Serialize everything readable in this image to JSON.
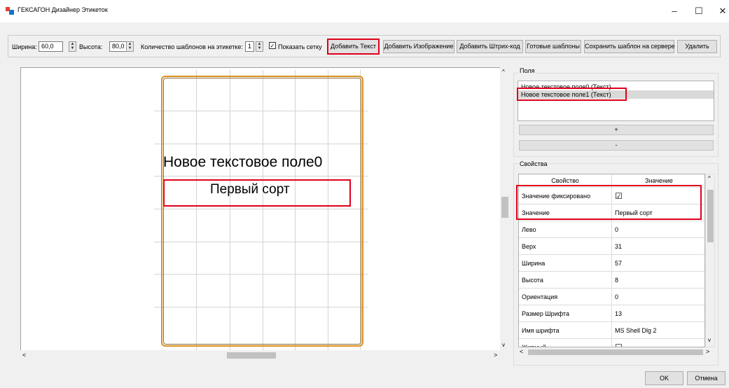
{
  "window": {
    "title": "ГЕКСАГОН Дизайнер Этикеток",
    "minimize": "–",
    "maximize": "☐",
    "close": "✕"
  },
  "toolbar": {
    "width_label": "Ширина:",
    "width_value": "60,0",
    "height_label": "Высота:",
    "height_value": "80,0",
    "count_label": "Количество шаблонов на этикетке:",
    "count_value": "1",
    "show_grid_label": "Показать сетку",
    "show_grid_checked": true,
    "add_text": "Добавить Текст",
    "add_image": "Добавить Изображение",
    "add_barcode": "Добавить Штрих-код",
    "ready_templates": "Готовые шаблоны",
    "save_template": "Сохранить шаблон на сервере",
    "delete": "Удалить"
  },
  "canvas": {
    "field0_text": "Новое текстовое поле0",
    "field1_text": "Первый сорт"
  },
  "fields_panel": {
    "title": "Поля",
    "items": [
      "Новое текстовое поле0 (Текст)",
      "Новое текстовое поле1 (Текст)"
    ],
    "add_button": "+",
    "remove_button": "-"
  },
  "properties_panel": {
    "title": "Свойства",
    "col_property": "Свойство",
    "col_value": "Значение",
    "rows": [
      {
        "name": "Значение фиксировано",
        "value": "☑"
      },
      {
        "name": "Значение",
        "value": "Первый сорт"
      },
      {
        "name": "Лево",
        "value": "0"
      },
      {
        "name": "Верх",
        "value": "31"
      },
      {
        "name": "Ширина",
        "value": "57"
      },
      {
        "name": "Высота",
        "value": "8"
      },
      {
        "name": "Ориентация",
        "value": "0"
      },
      {
        "name": "Размер Шрифта",
        "value": "13"
      },
      {
        "name": "Имя шрифта",
        "value": "MS Shell Dlg 2"
      },
      {
        "name": "Жирный",
        "value": "☐"
      }
    ]
  },
  "footer": {
    "ok": "OK",
    "cancel": "Отмена"
  },
  "colors": {
    "highlight": "#e0001a",
    "label_border": "#d9901f"
  }
}
